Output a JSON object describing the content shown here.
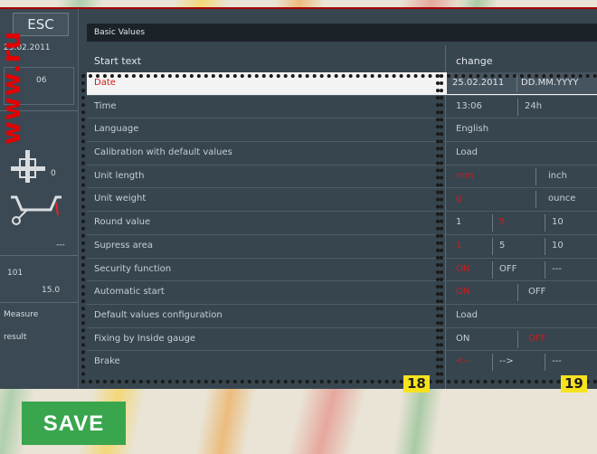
{
  "watermark": "www.ru",
  "left_panel": {
    "esc_label": "ESC",
    "date": "25.02.2011",
    "time": "06",
    "value_zero": "0",
    "dashes": "---",
    "value_a": "101",
    "value_b": "15.0",
    "measure": "Measure",
    "result": "result"
  },
  "header": {
    "title": "Basic Values"
  },
  "columns": {
    "setting": "Start text",
    "change": "change"
  },
  "rows": [
    {
      "label": "Date",
      "values": [
        "25.02.2011",
        "DD.MM.YYYY"
      ]
    },
    {
      "label": "Time",
      "values": [
        "13:06",
        "24h"
      ]
    },
    {
      "label": "Language",
      "values": [
        "English"
      ]
    },
    {
      "label": "Calibration with default values",
      "values": [
        "Load"
      ]
    },
    {
      "label": "Unit length",
      "values": [
        "mm",
        "inch"
      ]
    },
    {
      "label": "Unit weight",
      "values": [
        "g",
        "ounce"
      ]
    },
    {
      "label": "Round value",
      "values": [
        "1",
        "5",
        "10"
      ]
    },
    {
      "label": "Supress area",
      "values": [
        "1",
        "5",
        "10"
      ]
    },
    {
      "label": "Security function",
      "values": [
        "ON",
        "OFF",
        "---"
      ]
    },
    {
      "label": "Automatic start",
      "values": [
        "ON",
        "OFF"
      ]
    },
    {
      "label": "Default values configuration",
      "values": [
        "Load"
      ]
    },
    {
      "label": "Fixing by Inside gauge",
      "values": [
        "ON",
        "OFF"
      ]
    },
    {
      "label": "Brake",
      "values": [
        "<--",
        "-->",
        "---"
      ]
    }
  ],
  "tags": {
    "left": "18",
    "right": "19"
  },
  "save_label": "SAVE",
  "colors": {
    "selected": "#d01a1a",
    "save": "#39a64e",
    "tag": "#f6e21d",
    "watermark": "#e30000"
  }
}
